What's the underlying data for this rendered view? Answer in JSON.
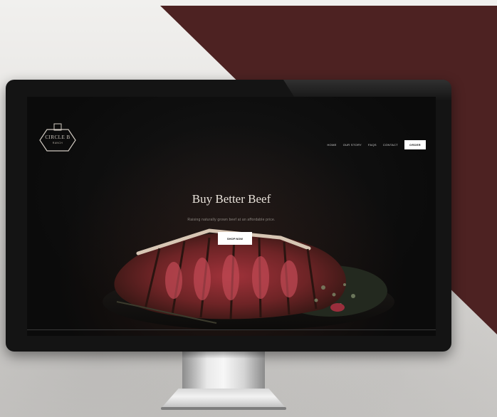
{
  "brand": {
    "logo_text": "CIRCLE B",
    "logo_sub": "RANCH"
  },
  "nav": {
    "items": [
      "Home",
      "Our Story",
      "FAQs",
      "Contact"
    ],
    "cta_label": "Order"
  },
  "hero": {
    "title": "Buy Better Beef",
    "subtitle": "Raising naturally grown beef at an affordable price.",
    "button_label": "Shop Now"
  },
  "colors": {
    "accent_maroon": "#4d2222",
    "screen_bg": "#0b0b0b"
  }
}
